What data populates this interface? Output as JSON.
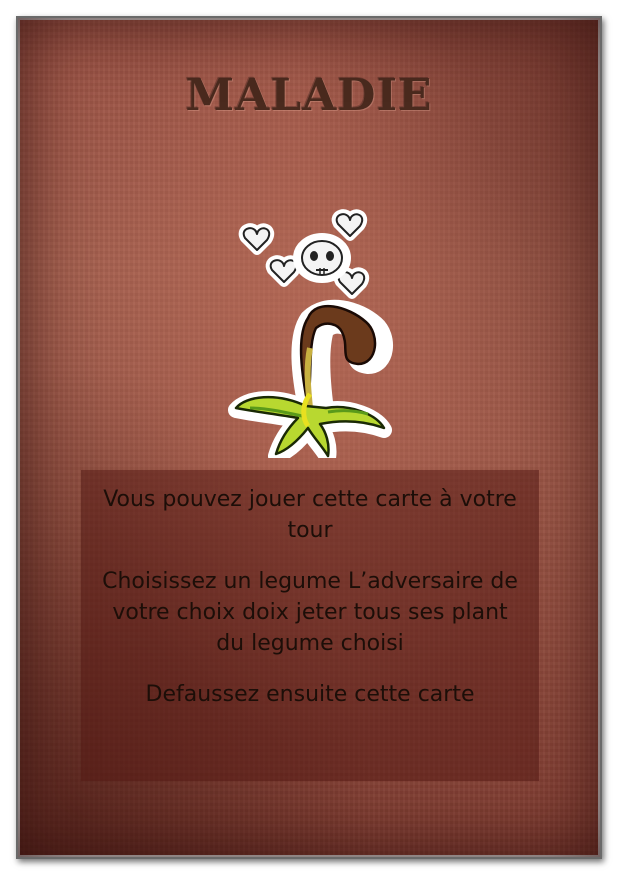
{
  "card": {
    "title": "MALADIE",
    "text": {
      "line1": "Vous pouvez jouer cette carte à votre tour",
      "line2": "Choisissez un legume L’adversaire de votre choix doix jeter tous ses plant du legume choisi",
      "line3": "Defaussez ensuite cette carte"
    },
    "icon": "wilted-sick-plant-with-skull-icon"
  },
  "colors": {
    "background": "#9b5244",
    "title": "#4a2a1e",
    "panel": "#581c16",
    "text": "#1c0e08"
  }
}
